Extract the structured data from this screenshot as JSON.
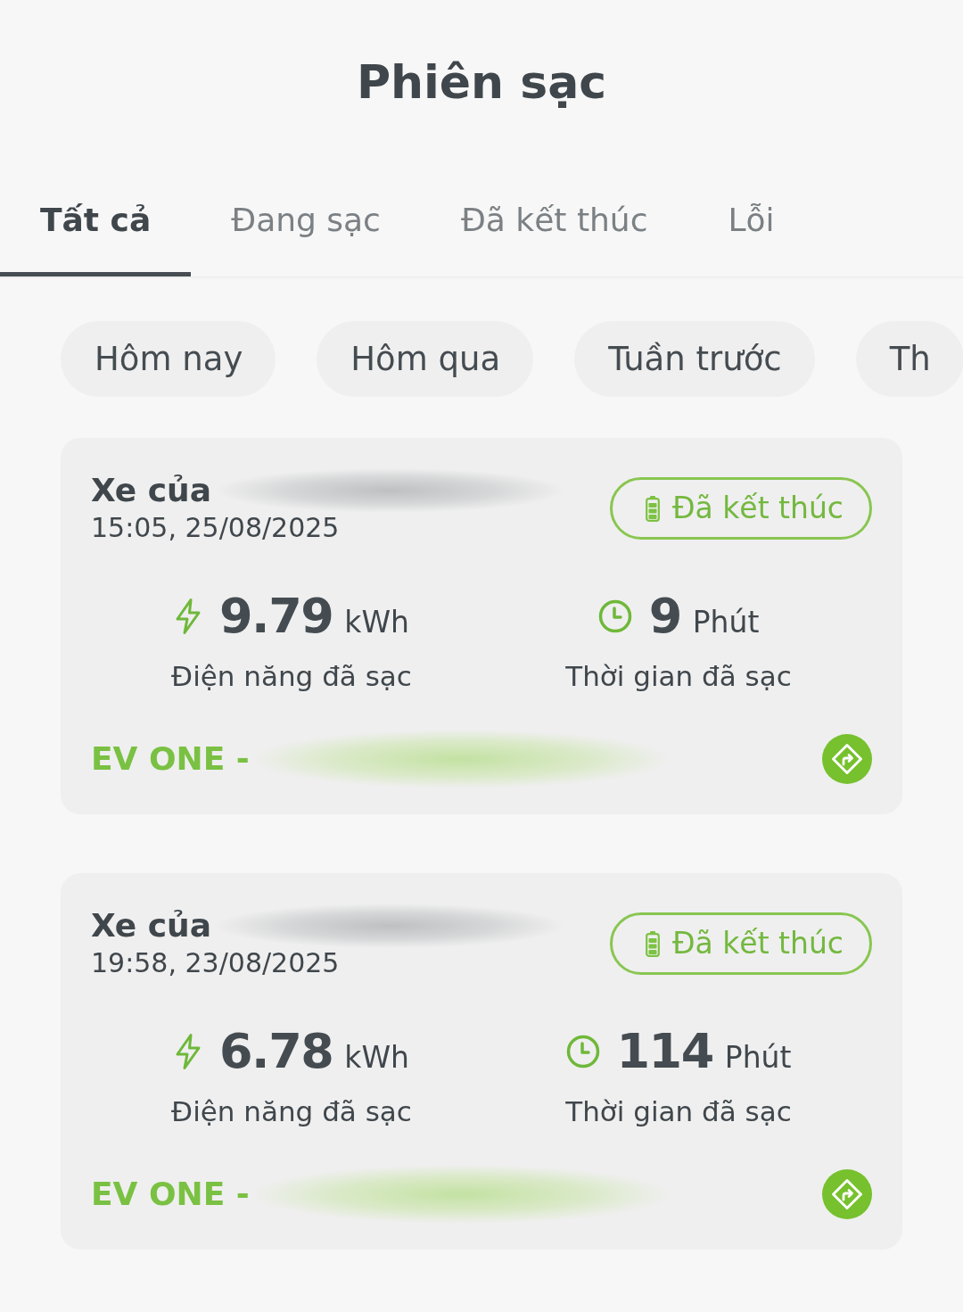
{
  "header": {
    "title": "Phiên sạc"
  },
  "tabs": [
    {
      "label": "Tất cả",
      "selected": true
    },
    {
      "label": "Đang sạc",
      "selected": false
    },
    {
      "label": "Đã kết thúc",
      "selected": false
    },
    {
      "label": "Lỗi",
      "selected": false
    }
  ],
  "filters": [
    {
      "label": "Hôm nay",
      "selected": false
    },
    {
      "label": "Hôm qua",
      "selected": false
    },
    {
      "label": "Tuần trước",
      "selected": false
    },
    {
      "label": "Th",
      "selected": false
    }
  ],
  "sessions": [
    {
      "vehicle_label": "Xe của",
      "name_blurred": true,
      "time": "15:05, 25/08/2025",
      "status": {
        "label": "Đã kết thúc",
        "kind": "finished"
      },
      "energy": {
        "value": "9.79",
        "unit": "kWh",
        "label": "Điện năng đã sạc"
      },
      "duration": {
        "value": "9",
        "unit": "Phút",
        "label": "Thời gian đã sạc"
      },
      "station": "EV ONE -",
      "station_blurred": true
    },
    {
      "vehicle_label": "Xe của",
      "name_blurred": true,
      "time": "19:58, 23/08/2025",
      "status": {
        "label": "Đã kết thúc",
        "kind": "finished"
      },
      "energy": {
        "value": "6.78",
        "unit": "kWh",
        "label": "Điện năng đã sạc"
      },
      "duration": {
        "value": "114",
        "unit": "Phút",
        "label": "Thời gian đã sạc"
      },
      "station": "EV ONE -",
      "station_blurred": true
    }
  ]
}
